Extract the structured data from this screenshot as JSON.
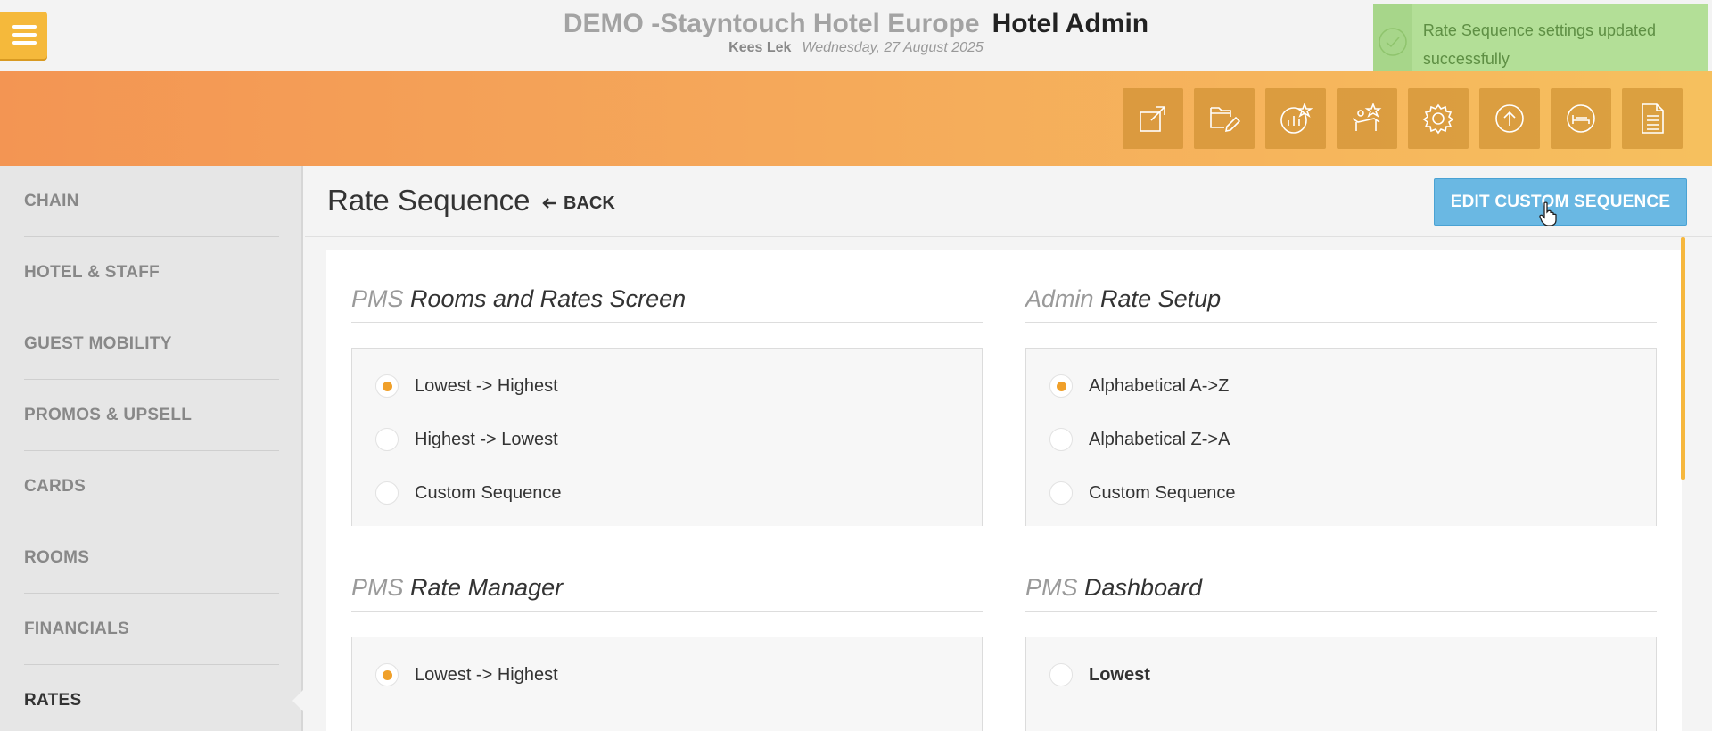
{
  "header": {
    "hotel_name": "DEMO -Stayntouch Hotel Europe",
    "app_name": "Hotel Admin",
    "user_name": "Kees Lek",
    "date": "Wednesday, 27 August 2025"
  },
  "toast": {
    "message": "Rate Sequence settings updated successfully",
    "color": "#b3df97"
  },
  "toolbar": {
    "icons": [
      "external-link-icon",
      "folder-edit-icon",
      "chart-star-icon",
      "guest-star-icon",
      "gear-icon",
      "upload-icon",
      "bed-icon",
      "document-icon"
    ]
  },
  "sidebar": {
    "items": [
      {
        "label": "CHAIN"
      },
      {
        "label": "HOTEL & STAFF"
      },
      {
        "label": "GUEST MOBILITY"
      },
      {
        "label": "PROMOS & UPSELL"
      },
      {
        "label": "CARDS"
      },
      {
        "label": "ROOMS"
      },
      {
        "label": "FINANCIALS"
      },
      {
        "label": "RATES"
      }
    ],
    "active": "RATES"
  },
  "main": {
    "title": "Rate Sequence",
    "back_label": "BACK",
    "edit_button": "EDIT CUSTOM SEQUENCE",
    "accent_color": "#6ab8e3"
  },
  "sections": {
    "pms_rooms_rates": {
      "prefix": "PMS",
      "title": "Rooms and Rates Screen",
      "options": [
        "Lowest -> Highest",
        "Highest -> Lowest",
        "Custom Sequence"
      ],
      "selected": "Lowest -> Highest"
    },
    "admin_rate_setup": {
      "prefix": "Admin",
      "title": "Rate Setup",
      "options": [
        "Alphabetical A->Z",
        "Alphabetical Z->A",
        "Custom Sequence"
      ],
      "selected": "Alphabetical A->Z"
    },
    "pms_rate_manager": {
      "prefix": "PMS",
      "title": "Rate Manager",
      "options": [
        "Lowest -> Highest"
      ],
      "selected": "Lowest -> Highest"
    },
    "pms_dashboard": {
      "prefix": "PMS",
      "title": "Dashboard",
      "options": [
        "Lowest"
      ],
      "selected": ""
    }
  }
}
